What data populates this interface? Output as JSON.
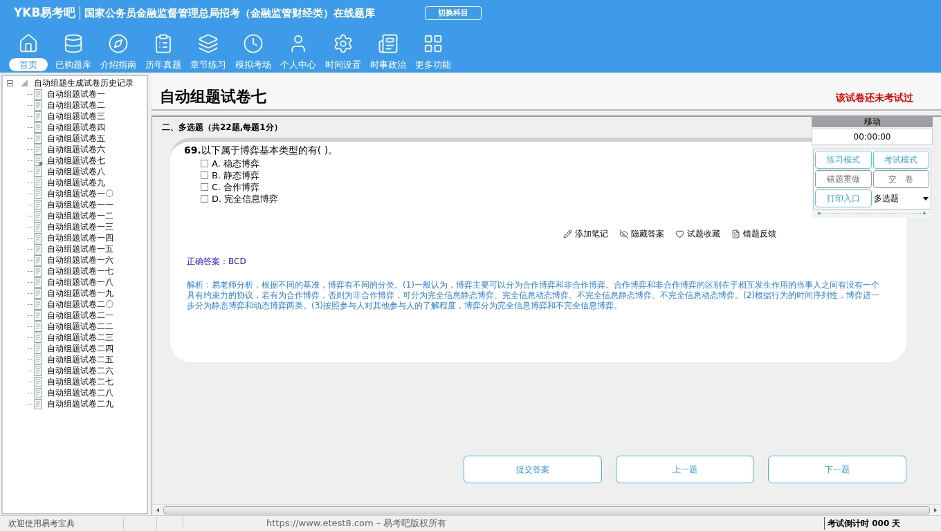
{
  "header": {
    "logo": "YKB易考吧",
    "title": "国家公务员金融监督管理总局招考（金融监管财经类）在线题库",
    "switch_button": "切换科目"
  },
  "nav": [
    {
      "label": "首页",
      "selected": true
    },
    {
      "label": "已购题库",
      "selected": false
    },
    {
      "label": "介绍指南",
      "selected": false
    },
    {
      "label": "历年真题",
      "selected": false
    },
    {
      "label": "章节练习",
      "selected": false
    },
    {
      "label": "模拟考场",
      "selected": false
    },
    {
      "label": "个人中心",
      "selected": false
    },
    {
      "label": "时间设置",
      "selected": false
    },
    {
      "label": "时事政治",
      "selected": false
    },
    {
      "label": "更多功能",
      "selected": false
    }
  ],
  "tree": {
    "label": "自动组题生成试卷历史记录",
    "expanded": true,
    "children": [
      {
        "label": "自动组题试卷一",
        "selected": false
      },
      {
        "label": "自动组题试卷二",
        "selected": false
      },
      {
        "label": "自动组题试卷三",
        "selected": false
      },
      {
        "label": "自动组题试卷四",
        "selected": false
      },
      {
        "label": "自动组题试卷五",
        "selected": false
      },
      {
        "label": "自动组题试卷六",
        "selected": false
      },
      {
        "label": "自动组题试卷七",
        "selected": true,
        "kind": "current"
      },
      {
        "label": "自动组题试卷八",
        "selected": false
      },
      {
        "label": "自动组题试卷九",
        "selected": false
      },
      {
        "label": "自动组题试卷一〇",
        "selected": false
      },
      {
        "label": "自动组题试卷一一",
        "selected": false
      },
      {
        "label": "自动组题试卷一二",
        "selected": false
      },
      {
        "label": "自动组题试卷一三",
        "selected": false
      },
      {
        "label": "自动组题试卷一四",
        "selected": false
      },
      {
        "label": "自动组题试卷一五",
        "selected": false
      },
      {
        "label": "自动组题试卷一六",
        "selected": false
      },
      {
        "label": "自动组题试卷一七",
        "selected": false
      },
      {
        "label": "自动组题试卷一八",
        "selected": false
      },
      {
        "label": "自动组题试卷一九",
        "selected": false
      },
      {
        "label": "自动组题试卷二〇",
        "selected": false
      },
      {
        "label": "自动组题试卷二一",
        "selected": false
      },
      {
        "label": "自动组题试卷二二",
        "selected": false
      },
      {
        "label": "自动组题试卷二三",
        "selected": false
      },
      {
        "label": "自动组题试卷二四",
        "selected": false
      },
      {
        "label": "自动组题试卷二五",
        "selected": false
      },
      {
        "label": "自动组题试卷二六",
        "selected": false
      },
      {
        "label": "自动组题试卷二七",
        "selected": false
      },
      {
        "label": "自动组题试卷二八",
        "selected": false
      },
      {
        "label": "自动组题试卷二九",
        "selected": false
      }
    ]
  },
  "paper": {
    "title": "自动组题试卷七",
    "status": "该试卷还未考试过",
    "section": "二、多选题（共22题,每题1分）"
  },
  "question": {
    "number": "69.",
    "stem": "以下属于博弈基本类型的有( )。",
    "options": [
      {
        "label": "A. 稳态博弈",
        "checked": false
      },
      {
        "label": "B. 静态博弈",
        "checked": false
      },
      {
        "label": "C. 合作博弈",
        "checked": false
      },
      {
        "label": "D. 完全信息博弈",
        "checked": false
      }
    ],
    "actions": [
      "添加笔记",
      "隐藏答案",
      "试题收藏",
      "错题反馈"
    ],
    "answer": "正确答案：BCD",
    "analysis": "解析：易老师分析，根据不同的基准，博弈有不同的分类。(1)一般认为，博弈主要可以分为合作博弈和非合作博弈。合作博弈和非合作博弈的区别在于相互发生作用的当事人之间有没有一个具有约束力的协议，若有为合作博弈，否则为非合作博弈，可分为完全信息静态博弈、完全信息动态博弈、不完全信息静态博弈、不完全信息动态博弈。(2)根据行为的时间序列性，博弈进一步分为静态博弈和动态博弈两类。(3)按照参与人对其他参与人的了解程度，博弈分为完全信息博弈和不完全信息博弈。"
  },
  "float_panel": {
    "title": "移动",
    "timer": "00:00:00",
    "buttons": [
      {
        "label": "练习模式",
        "kind": "primary"
      },
      {
        "label": "考试模式",
        "kind": "primary"
      },
      {
        "label": "错题重做",
        "kind": "secondary"
      },
      {
        "label": "交　卷",
        "kind": "secondary"
      },
      {
        "label": "打印入口",
        "kind": "primary"
      }
    ],
    "type_select": "多选题"
  },
  "bottom_buttons": [
    "提交答案",
    "上一题",
    "下一题"
  ],
  "status_bar": {
    "welcome": "欢迎使用易考宝典",
    "copyright": "https://www.etest8.com – 易考吧版权所有",
    "countdown": "考试倒计时 000 天"
  }
}
